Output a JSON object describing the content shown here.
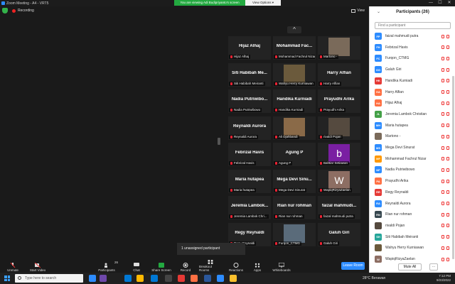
{
  "window": {
    "title": "Zoom Meeting - A4 - VRT5",
    "minimize": "—",
    "maximize": "☐",
    "close": "✕"
  },
  "banner": {
    "viewing": "You are viewing Adi Budipriyanto's screen",
    "view_options": "View Options ▾"
  },
  "meeting": {
    "recording": "Recording",
    "view": "View",
    "collapse": "^",
    "unassigned": "1 unassigned participant"
  },
  "tiles": [
    {
      "name": "Hijaz Alhaj",
      "label": "Hijaz Alhaj",
      "photo": false
    },
    {
      "name": "Mohammad Fac...",
      "label": "Mohammad Fachrul Nizar",
      "photo": false
    },
    {
      "name": "",
      "label": "Martono -",
      "photo": true,
      "photo_color": "#7a6a5a"
    },
    {
      "name": "Siti Habibah Me...",
      "label": "Siti Habibah Meiranti",
      "photo": false
    },
    {
      "name": "",
      "label": "Wahyu Herry Kurniawan",
      "photo": true,
      "photo_color": "#6b5a3c"
    },
    {
      "name": "Harry Alfian",
      "label": "Harry Alfian",
      "photo": false
    },
    {
      "name": "Nadia Putriwibo...",
      "label": "Nadia Putriwibowo",
      "photo": false
    },
    {
      "name": "Handika Kurniadi",
      "label": "Handika Kurniadi",
      "photo": false
    },
    {
      "name": "Prayudhi Arika",
      "label": "Prayudhi Arika",
      "photo": false
    },
    {
      "name": "Reynaldi Aurora",
      "label": "Reynaldi Aurora",
      "photo": false
    },
    {
      "name": "",
      "label": "Ali Djahbandi",
      "photo": true,
      "photo_color": "#8a6a48"
    },
    {
      "name": "",
      "label": "rivaldi Pojan",
      "photo": true,
      "photo_color": "#554a3f"
    },
    {
      "name": "Febrizal Havis",
      "label": "Febrizal Havis",
      "photo": false
    },
    {
      "name": "Agung P",
      "label": "Agung P",
      "photo": false
    },
    {
      "name": "",
      "label": "Bahtiar Setiawan",
      "photo": true,
      "photo_color": "#7a1fa2",
      "letter": "b"
    },
    {
      "name": "Maria hutapea",
      "label": "Maria hutapea",
      "photo": false
    },
    {
      "name": "Mega Devi Sinu...",
      "label": "Mega Devi Sinurat",
      "photo": false
    },
    {
      "name": "",
      "label": "WapiqRizyaZaelan",
      "photo": true,
      "photo_color": "#8d6e63",
      "letter": "W"
    },
    {
      "name": "Jeremia Lambok...",
      "label": "Jeremia Lambok Chri...",
      "photo": false
    },
    {
      "name": "Rian nur rohman",
      "label": "Rian nur rohman",
      "photo": false
    },
    {
      "name": "faizal mahmudi...",
      "label": "faizal mahmudi putra",
      "photo": false
    },
    {
      "name": "Regy Reynaldi",
      "label": "Regy Reynaldi",
      "photo": false
    },
    {
      "name": "",
      "label": "Furqon_CTMG",
      "photo": true,
      "photo_color": "#5a6b7a"
    },
    {
      "name": "Galuh Giri",
      "label": "Galuh Giri",
      "photo": false
    }
  ],
  "toolbar": {
    "unmute": "Unmute",
    "start_video": "Start Video",
    "participants": "Participants",
    "participants_count": "26",
    "chat": "Chat",
    "share": "Share Screen",
    "record": "Record",
    "breakout": "Breakout Rooms",
    "reactions": "Reactions",
    "apps": "Apps",
    "whiteboards": "Whiteboards",
    "leave": "Leave Room"
  },
  "panel": {
    "title": "Participants (26)",
    "chevron": "⌄",
    "search_placeholder": "Find a participant",
    "mute_all": "Mute All",
    "more": "...",
    "participants": [
      {
        "initials": "FP",
        "name": "faizal mahmudi putra",
        "color": "#2d8cff"
      },
      {
        "initials": "FH",
        "name": "Febrizal Havis",
        "color": "#2d8cff"
      },
      {
        "initials": "FC",
        "name": "Furqon_CTMG",
        "color": "#2d8cff"
      },
      {
        "initials": "GG",
        "name": "Galuh Giri",
        "color": "#2d8cff"
      },
      {
        "initials": "HK",
        "name": "Handika Kurniadi",
        "color": "#e53935"
      },
      {
        "initials": "HA",
        "name": "Harry Alfian",
        "color": "#ff7043"
      },
      {
        "initials": "HA",
        "name": "Hijaz Alhaj",
        "color": "#ff7043"
      },
      {
        "initials": "JL",
        "name": "Jeremia Lambok Christian",
        "color": "#43a047"
      },
      {
        "initials": "MH",
        "name": "Maria hutapea",
        "color": "#2d8cff"
      },
      {
        "initials": "",
        "name": "Martono -",
        "color": "#7a6a5a"
      },
      {
        "initials": "MS",
        "name": "Mega Devi Sinurat",
        "color": "#2d8cff"
      },
      {
        "initials": "MF",
        "name": "Mohammad Fachrul Nizar",
        "color": "#ff9800"
      },
      {
        "initials": "NP",
        "name": "Nadia Putriwibowo",
        "color": "#2d8cff"
      },
      {
        "initials": "PA",
        "name": "Prayudhi Arika",
        "color": "#ff7043"
      },
      {
        "initials": "RR",
        "name": "Regy Reynaldi",
        "color": "#e53935"
      },
      {
        "initials": "RA",
        "name": "Reynaldi Aurora",
        "color": "#2d8cff"
      },
      {
        "initials": "RN",
        "name": "Rian nur rohman",
        "color": "#37474f"
      },
      {
        "initials": "",
        "name": "rivaldi Pojan",
        "color": "#554a3f"
      },
      {
        "initials": "SH",
        "name": "Siti Habibah Meiranti",
        "color": "#26a69a"
      },
      {
        "initials": "",
        "name": "Wahyu Herry Kurniawan",
        "color": "#6b5a3c"
      },
      {
        "initials": "W",
        "name": "WapiqRizyaZaelan",
        "color": "#8d6e63"
      }
    ]
  },
  "taskbar": {
    "search": "Type here to search",
    "weather": "28°C Berawan",
    "time": "7:12 PM",
    "date": "9/23/2022"
  }
}
